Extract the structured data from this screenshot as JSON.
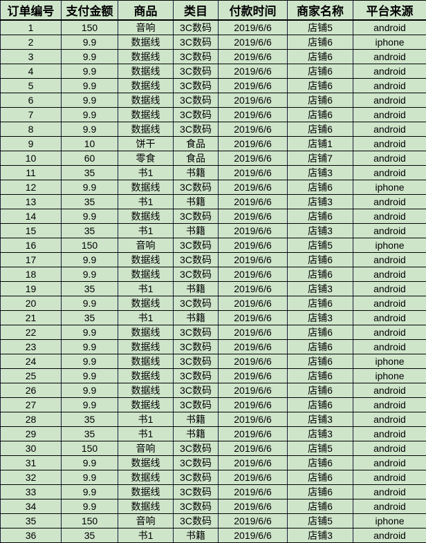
{
  "table": {
    "name": "order-table",
    "columns": [
      {
        "key": "id",
        "label": "订单编号",
        "class": "c-id"
      },
      {
        "key": "amount",
        "label": "支付金额",
        "class": "c-amount"
      },
      {
        "key": "product",
        "label": "商品",
        "class": "c-prod"
      },
      {
        "key": "category",
        "label": "类目",
        "class": "c-cat"
      },
      {
        "key": "pay_time",
        "label": "付款时间",
        "class": "c-time"
      },
      {
        "key": "shop",
        "label": "商家名称",
        "class": "c-shop"
      },
      {
        "key": "platform",
        "label": "平台来源",
        "class": "c-plat"
      }
    ],
    "rows": [
      [
        "1",
        "150",
        "音响",
        "3C数码",
        "2019/6/6",
        "店铺5",
        "android"
      ],
      [
        "2",
        "9.9",
        "数据线",
        "3C数码",
        "2019/6/6",
        "店铺6",
        "iphone"
      ],
      [
        "3",
        "9.9",
        "数据线",
        "3C数码",
        "2019/6/6",
        "店铺6",
        "android"
      ],
      [
        "4",
        "9.9",
        "数据线",
        "3C数码",
        "2019/6/6",
        "店铺6",
        "android"
      ],
      [
        "5",
        "9.9",
        "数据线",
        "3C数码",
        "2019/6/6",
        "店铺6",
        "android"
      ],
      [
        "6",
        "9.9",
        "数据线",
        "3C数码",
        "2019/6/6",
        "店铺6",
        "android"
      ],
      [
        "7",
        "9.9",
        "数据线",
        "3C数码",
        "2019/6/6",
        "店铺6",
        "android"
      ],
      [
        "8",
        "9.9",
        "数据线",
        "3C数码",
        "2019/6/6",
        "店铺6",
        "android"
      ],
      [
        "9",
        "10",
        "饼干",
        "食品",
        "2019/6/6",
        "店铺1",
        "android"
      ],
      [
        "10",
        "60",
        "零食",
        "食品",
        "2019/6/6",
        "店铺7",
        "android"
      ],
      [
        "11",
        "35",
        "书1",
        "书籍",
        "2019/6/6",
        "店铺3",
        "android"
      ],
      [
        "12",
        "9.9",
        "数据线",
        "3C数码",
        "2019/6/6",
        "店铺6",
        "iphone"
      ],
      [
        "13",
        "35",
        "书1",
        "书籍",
        "2019/6/6",
        "店铺3",
        "android"
      ],
      [
        "14",
        "9.9",
        "数据线",
        "3C数码",
        "2019/6/6",
        "店铺6",
        "android"
      ],
      [
        "15",
        "35",
        "书1",
        "书籍",
        "2019/6/6",
        "店铺3",
        "android"
      ],
      [
        "16",
        "150",
        "音响",
        "3C数码",
        "2019/6/6",
        "店铺5",
        "iphone"
      ],
      [
        "17",
        "9.9",
        "数据线",
        "3C数码",
        "2019/6/6",
        "店铺6",
        "android"
      ],
      [
        "18",
        "9.9",
        "数据线",
        "3C数码",
        "2019/6/6",
        "店铺6",
        "android"
      ],
      [
        "19",
        "35",
        "书1",
        "书籍",
        "2019/6/6",
        "店铺3",
        "android"
      ],
      [
        "20",
        "9.9",
        "数据线",
        "3C数码",
        "2019/6/6",
        "店铺6",
        "android"
      ],
      [
        "21",
        "35",
        "书1",
        "书籍",
        "2019/6/6",
        "店铺3",
        "android"
      ],
      [
        "22",
        "9.9",
        "数据线",
        "3C数码",
        "2019/6/6",
        "店铺6",
        "android"
      ],
      [
        "23",
        "9.9",
        "数据线",
        "3C数码",
        "2019/6/6",
        "店铺6",
        "android"
      ],
      [
        "24",
        "9.9",
        "数据线",
        "3C数码",
        "2019/6/6",
        "店铺6",
        "iphone"
      ],
      [
        "25",
        "9.9",
        "数据线",
        "3C数码",
        "2019/6/6",
        "店铺6",
        "iphone"
      ],
      [
        "26",
        "9.9",
        "数据线",
        "3C数码",
        "2019/6/6",
        "店铺6",
        "android"
      ],
      [
        "27",
        "9.9",
        "数据线",
        "3C数码",
        "2019/6/6",
        "店铺6",
        "android"
      ],
      [
        "28",
        "35",
        "书1",
        "书籍",
        "2019/6/6",
        "店铺3",
        "android"
      ],
      [
        "29",
        "35",
        "书1",
        "书籍",
        "2019/6/6",
        "店铺3",
        "android"
      ],
      [
        "30",
        "150",
        "音响",
        "3C数码",
        "2019/6/6",
        "店铺5",
        "android"
      ],
      [
        "31",
        "9.9",
        "数据线",
        "3C数码",
        "2019/6/6",
        "店铺6",
        "android"
      ],
      [
        "32",
        "9.9",
        "数据线",
        "3C数码",
        "2019/6/6",
        "店铺6",
        "android"
      ],
      [
        "33",
        "9.9",
        "数据线",
        "3C数码",
        "2019/6/6",
        "店铺6",
        "android"
      ],
      [
        "34",
        "9.9",
        "数据线",
        "3C数码",
        "2019/6/6",
        "店铺6",
        "android"
      ],
      [
        "35",
        "150",
        "音响",
        "3C数码",
        "2019/6/6",
        "店铺5",
        "iphone"
      ],
      [
        "36",
        "35",
        "书1",
        "书籍",
        "2019/6/6",
        "店铺3",
        "android"
      ]
    ]
  },
  "colors": {
    "cell_fill": "#cee5ca",
    "grid_line": "#000000",
    "text": "#000000"
  }
}
